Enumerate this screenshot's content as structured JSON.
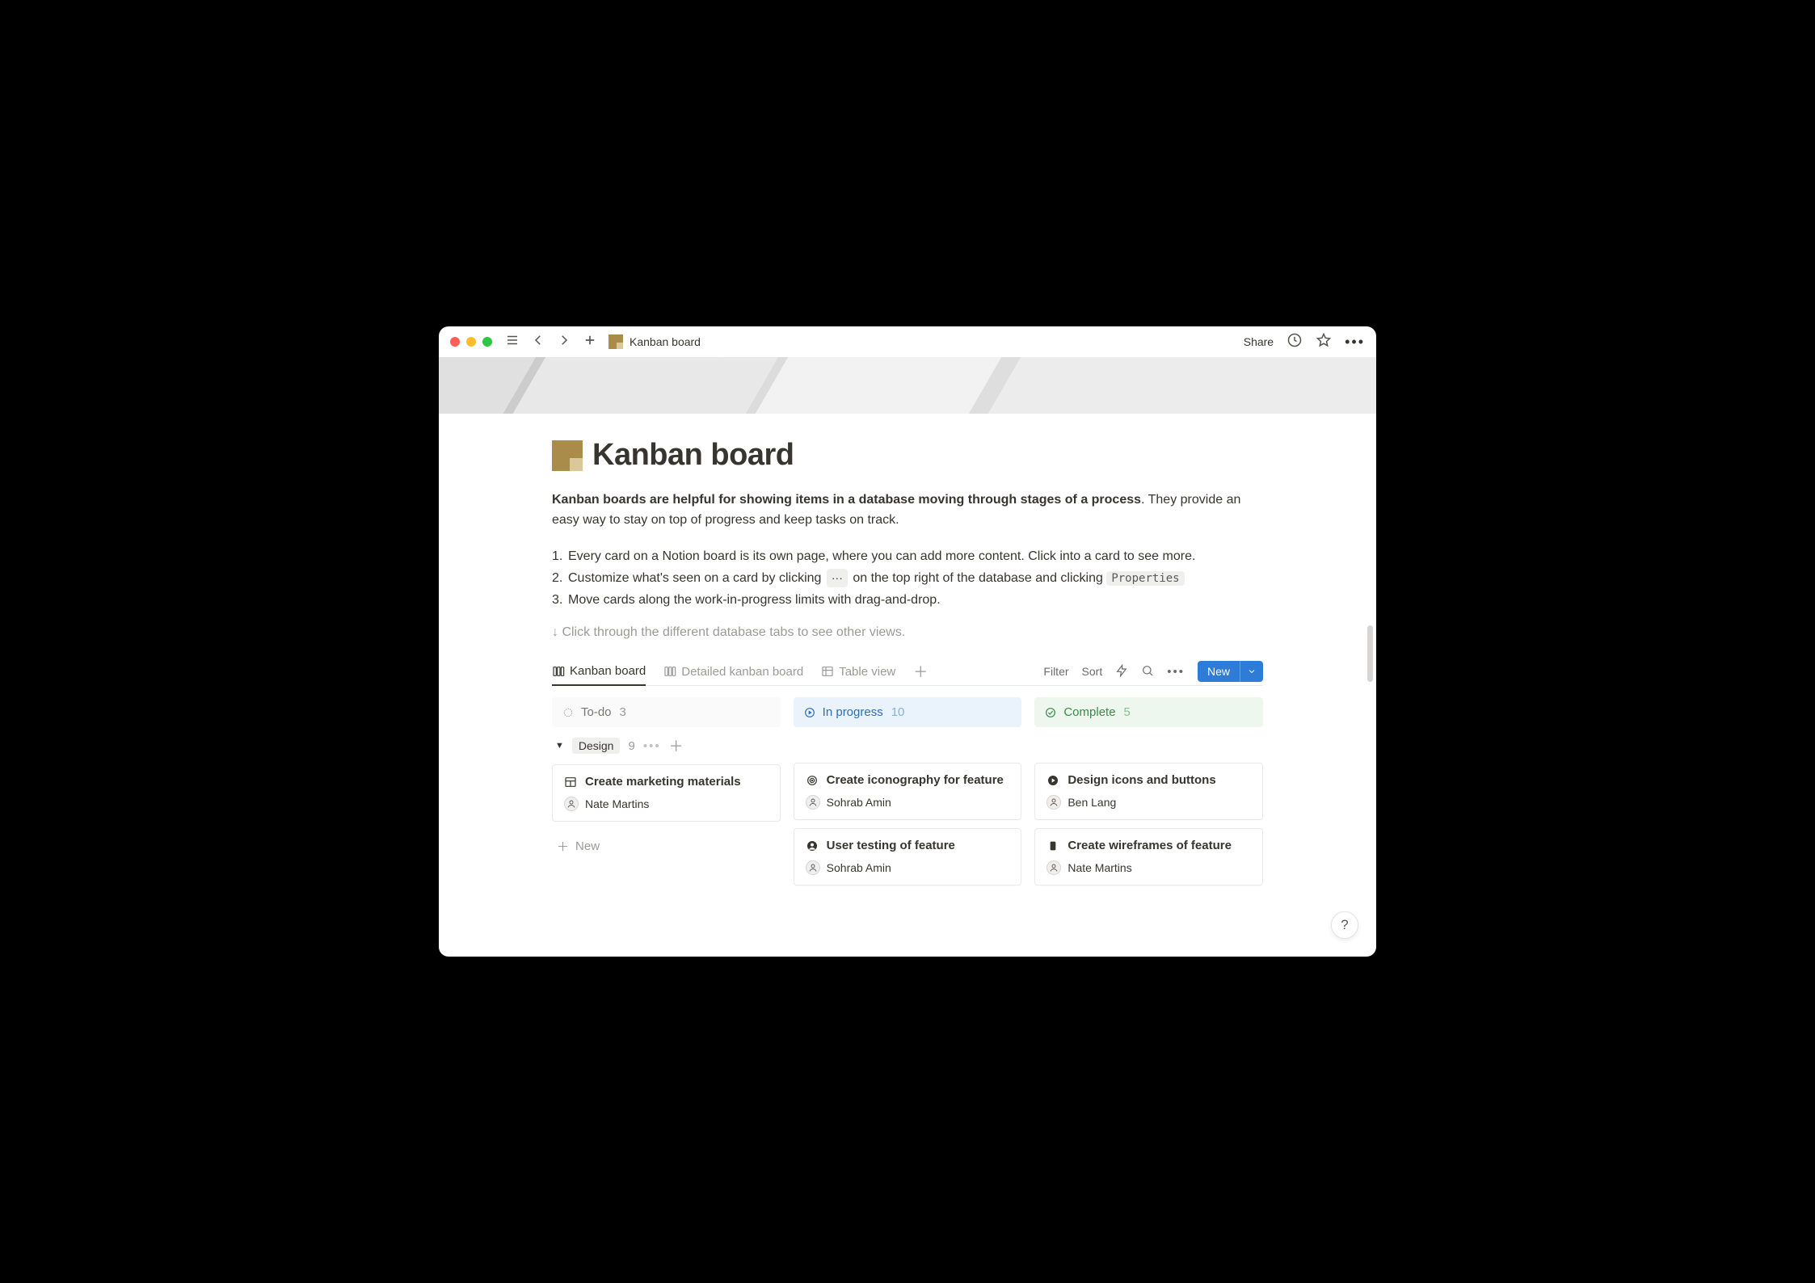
{
  "breadcrumb_title": "Kanban board",
  "toolbar": {
    "share": "Share"
  },
  "page": {
    "title": "Kanban board",
    "intro_bold": "Kanban boards are helpful for showing items in a database moving through stages of a process",
    "intro_rest": ". They provide an easy way to stay on top of progress and keep tasks on track.",
    "steps": [
      "Every card on a Notion board is its own page, where you can add more content. Click into a card to see more.",
      "Customize what's seen on a card by clicking  ···  on the top right of the database and clicking ",
      "Move cards along the work-in-progress limits with drag-and-drop."
    ],
    "properties_kbd": "Properties",
    "hint": "↓ Click through the different database tabs to see other views."
  },
  "db": {
    "tabs": [
      {
        "label": "Kanban board",
        "kind": "board",
        "active": true
      },
      {
        "label": "Detailed kanban board",
        "kind": "board"
      },
      {
        "label": "Table view",
        "kind": "table"
      }
    ],
    "toolbar": {
      "filter": "Filter",
      "sort": "Sort",
      "new": "New"
    },
    "columns": [
      {
        "id": "todo",
        "label": "To-do",
        "count": 3,
        "style": "todo"
      },
      {
        "id": "prog",
        "label": "In progress",
        "count": 10,
        "style": "prog"
      },
      {
        "id": "comp",
        "label": "Complete",
        "count": 5,
        "style": "comp"
      }
    ],
    "group": {
      "label": "Design",
      "count": 9
    },
    "cards": {
      "todo": [
        {
          "icon": "layout",
          "title": "Create marketing materials",
          "person": "Nate Martins"
        }
      ],
      "prog": [
        {
          "icon": "target",
          "title": "Create iconography for feature",
          "person": "Sohrab Amin"
        },
        {
          "icon": "user-solid",
          "title": "User testing of feature",
          "person": "Sohrab Amin"
        }
      ],
      "comp": [
        {
          "icon": "play-solid",
          "title": "Design icons and buttons",
          "person": "Ben Lang"
        },
        {
          "icon": "book-solid",
          "title": "Create wireframes of feature",
          "person": "Nate Martins"
        }
      ]
    },
    "add_label": "New"
  }
}
